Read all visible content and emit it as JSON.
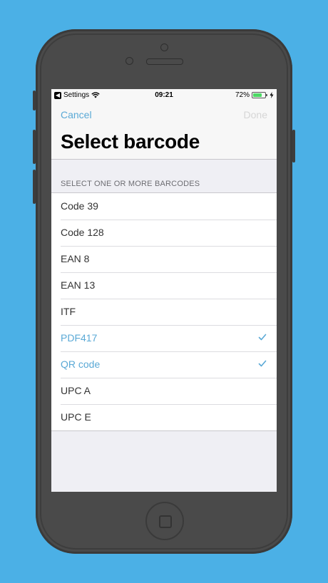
{
  "status_bar": {
    "back_label": "Settings",
    "time": "09:21",
    "battery": "72%",
    "battery_level": 0.72
  },
  "nav": {
    "cancel_label": "Cancel",
    "done_label": "Done",
    "title": "Select barcode"
  },
  "section": {
    "header": "SELECT ONE OR MORE BARCODES"
  },
  "barcodes": [
    {
      "label": "Code 39",
      "selected": false
    },
    {
      "label": "Code 128",
      "selected": false
    },
    {
      "label": "EAN 8",
      "selected": false
    },
    {
      "label": "EAN 13",
      "selected": false
    },
    {
      "label": "ITF",
      "selected": false
    },
    {
      "label": "PDF417",
      "selected": true
    },
    {
      "label": "QR code",
      "selected": true
    },
    {
      "label": "UPC A",
      "selected": false
    },
    {
      "label": "UPC E",
      "selected": false
    }
  ],
  "colors": {
    "background": "#4bb0e6",
    "accent": "#5aa9d6",
    "done_disabled": "#d6d6d6",
    "battery_fill": "#4cd964"
  },
  "icons": [
    "back-arrow-icon",
    "wifi-icon",
    "battery-icon",
    "charging-bolt-icon",
    "checkmark-icon",
    "home-button-icon"
  ]
}
